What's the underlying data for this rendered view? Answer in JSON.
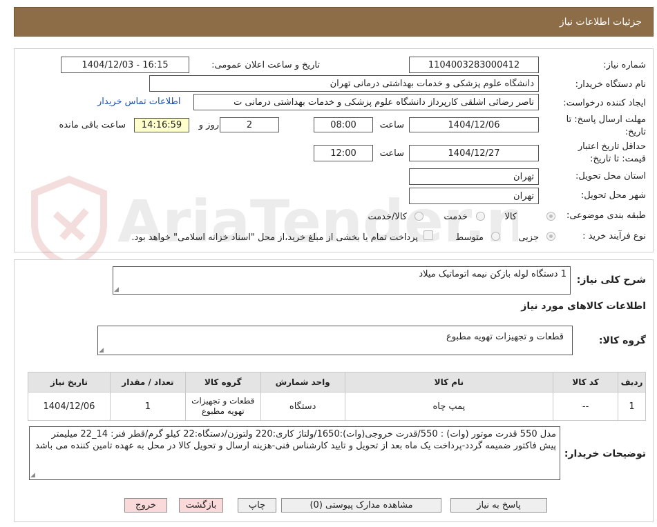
{
  "header": {
    "title": "جزئیات اطلاعات نیاز"
  },
  "watermark": {
    "text": "AriaTender.neT"
  },
  "fields": {
    "need_number_label": "شماره نیاز:",
    "need_number": "1104003283000412",
    "announce_label": "تاریخ و ساعت اعلان عمومی:",
    "announce_value": "1404/12/03 - 16:15",
    "buyer_org_label": "نام دستگاه خریدار:",
    "buyer_org": "دانشگاه علوم پزشکی و خدمات بهداشتی درمانی تهران",
    "requester_label": "ایجاد کننده درخواست:",
    "requester": "ناصر رضائی اشلقی کارپرداز دانشگاه علوم پزشکی و خدمات بهداشتی درمانی ت",
    "contact_link": "اطلاعات تماس خریدار",
    "deadline_label_1": "مهلت ارسال پاسخ: تا",
    "deadline_label_2": "تاریخ:",
    "deadline_date": "1404/12/06",
    "time_label": "ساعت",
    "deadline_time": "08:00",
    "days_value": "2",
    "days_label": "روز و",
    "remaining_time": "14:16:59",
    "remaining_label": "ساعت باقی مانده",
    "validity_label_1": "حداقل تاریخ اعتبار",
    "validity_label_2": "قیمت: تا تاریخ:",
    "validity_date": "1404/12/27",
    "validity_time_label": "ساعت",
    "validity_time": "12:00",
    "province_label": "استان محل تحویل:",
    "province": "تهران",
    "city_label": "شهر محل تحویل:",
    "city": "تهران",
    "category_label": "طبقه بندی موضوعی:",
    "category_options": [
      "کالا",
      "خدمت",
      "کالا/خدمت"
    ],
    "process_label": "نوع فرآیند خرید :",
    "process_options": [
      "جزیی",
      "متوسط"
    ],
    "treasury_note": "پرداخت تمام یا بخشی از مبلغ خرید،از محل \"اسناد خزانه اسلامی\" خواهد بود."
  },
  "description": {
    "label": "شرح کلی نیاز:",
    "value": "1 دستگاه لوله بازکن نیمه اتوماتیک میلاد"
  },
  "goods_info": {
    "heading": "اطلاعات کالاهای مورد نیاز",
    "group_label": "گروه کالا:",
    "group_value": "قطعات و تجهیزات تهویه مطبوع"
  },
  "table": {
    "headers": [
      "ردیف",
      "کد کالا",
      "نام کالا",
      "واحد شمارش",
      "گروه کالا",
      "تعداد / مقدار",
      "تاریخ نیاز"
    ],
    "rows": [
      [
        "1",
        "--",
        "پمپ چاه",
        "دستگاه",
        "قطعات و تجهیزات تهویه مطبوع",
        "1",
        "1404/12/06"
      ]
    ]
  },
  "buyer_notes": {
    "label": "توضیحات خریدار:",
    "lines": [
      "مدل 550 قدرت موتور (وات) : 550/قدرت خروجی(وات):1650/ولتاژ کاری:220 ولتوزن/دستگاه:22 کیلو گرم/قطر فنر: 14_22 میلیمتر",
      "پیش فاکتور ضمیمه گردد-پرداخت یک ماه بعد از تحویل و تایید کارشناس فنی-هزینه ارسال و تحویل کالا در محل به عهده تامین کننده می باشد"
    ]
  },
  "buttons": {
    "reply": "پاسخ به نیاز",
    "attachments": "مشاهده مدارک پیوستی (0)",
    "print": "چاپ",
    "back": "بازگشت",
    "exit": "خروج"
  }
}
